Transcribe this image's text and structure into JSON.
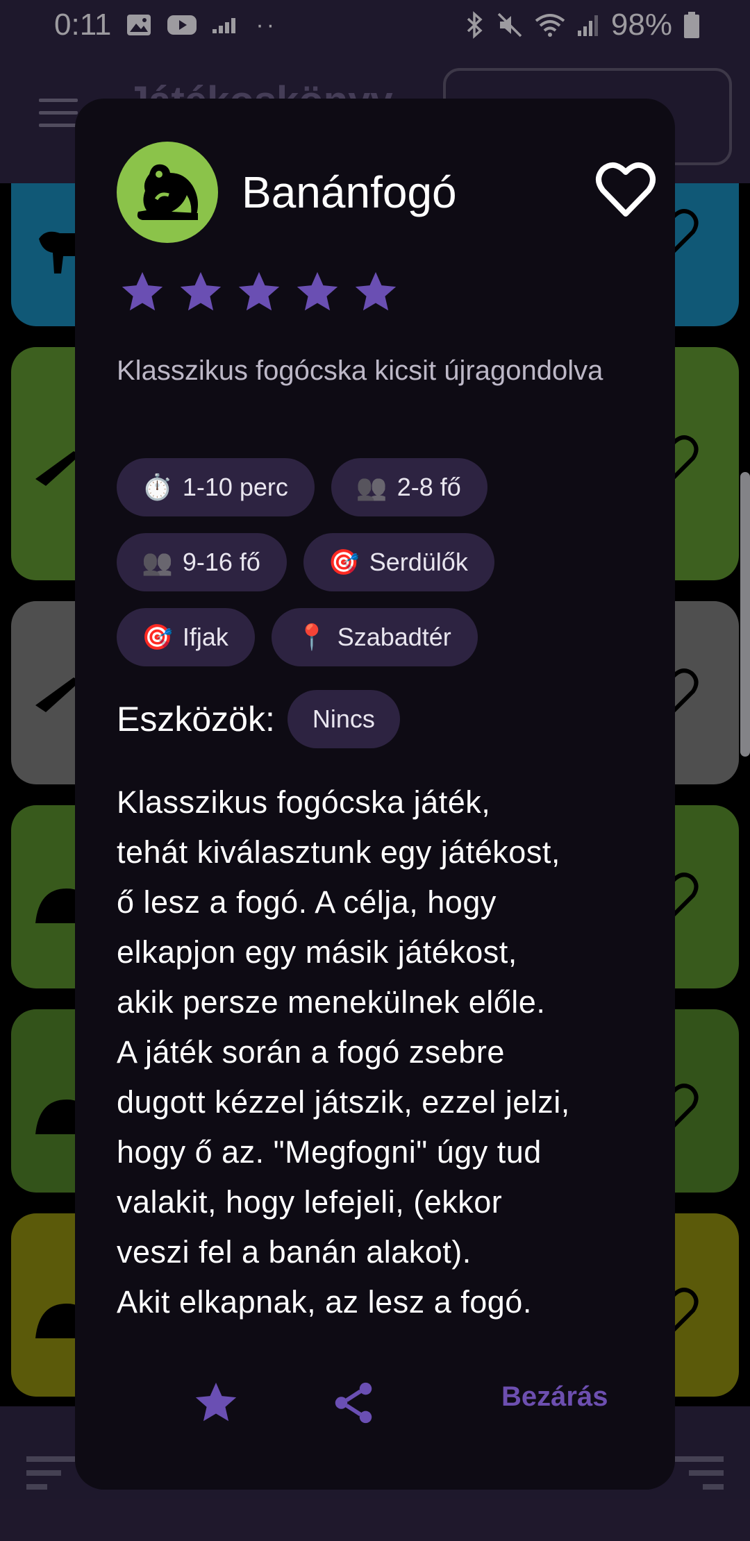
{
  "status_bar": {
    "time": "0:11",
    "battery": "98%"
  },
  "app_bar": {
    "title": "Játékoskönyv"
  },
  "colors": {
    "accent": "#6d4fb0",
    "star": "#6a4fb3",
    "chip_bg": "#2d2341",
    "avatar_bg": "#8bc34a",
    "card_colors": [
      "#1a88b5",
      "#5f9430",
      "#7a7a7a",
      "#568a2c",
      "#4f8028",
      "#8c8a10"
    ]
  },
  "dialog": {
    "icon": "frog-icon",
    "title": "Banánfogó",
    "rating": 5,
    "subtitle": "Klasszikus fogócska kicsit újragondolva",
    "chips": [
      {
        "icon": "⏱️",
        "label": "1-10 perc"
      },
      {
        "icon": "👥",
        "label": "2-8 fő"
      },
      {
        "icon": "👥",
        "label": "9-16 fő"
      },
      {
        "icon": "🎯",
        "label": "Serdülők"
      },
      {
        "icon": "🎯",
        "label": "Ifjak"
      },
      {
        "icon": "📍",
        "label": "Szabadtér"
      }
    ],
    "tools_label": "Eszközök:",
    "tools_value": "Nincs",
    "description": "Klasszikus fogócska játék,\ntehát kiválasztunk egy játékost,\nő lesz a fogó. A célja, hogy\nelkapjon egy másik játékost,\nakik persze menekülnek előle.\nA játék során a fogó zsebre\ndugott kézzel játszik, ezzel jelzi,\nhogy ő az. \"Megfogni\" úgy tud\nvalakit, hogy lefejeli, (ekkor\nveszi fel a banán alakot).\nAkit elkapnak, az lesz a fogó.",
    "close_label": "Bezárás"
  }
}
